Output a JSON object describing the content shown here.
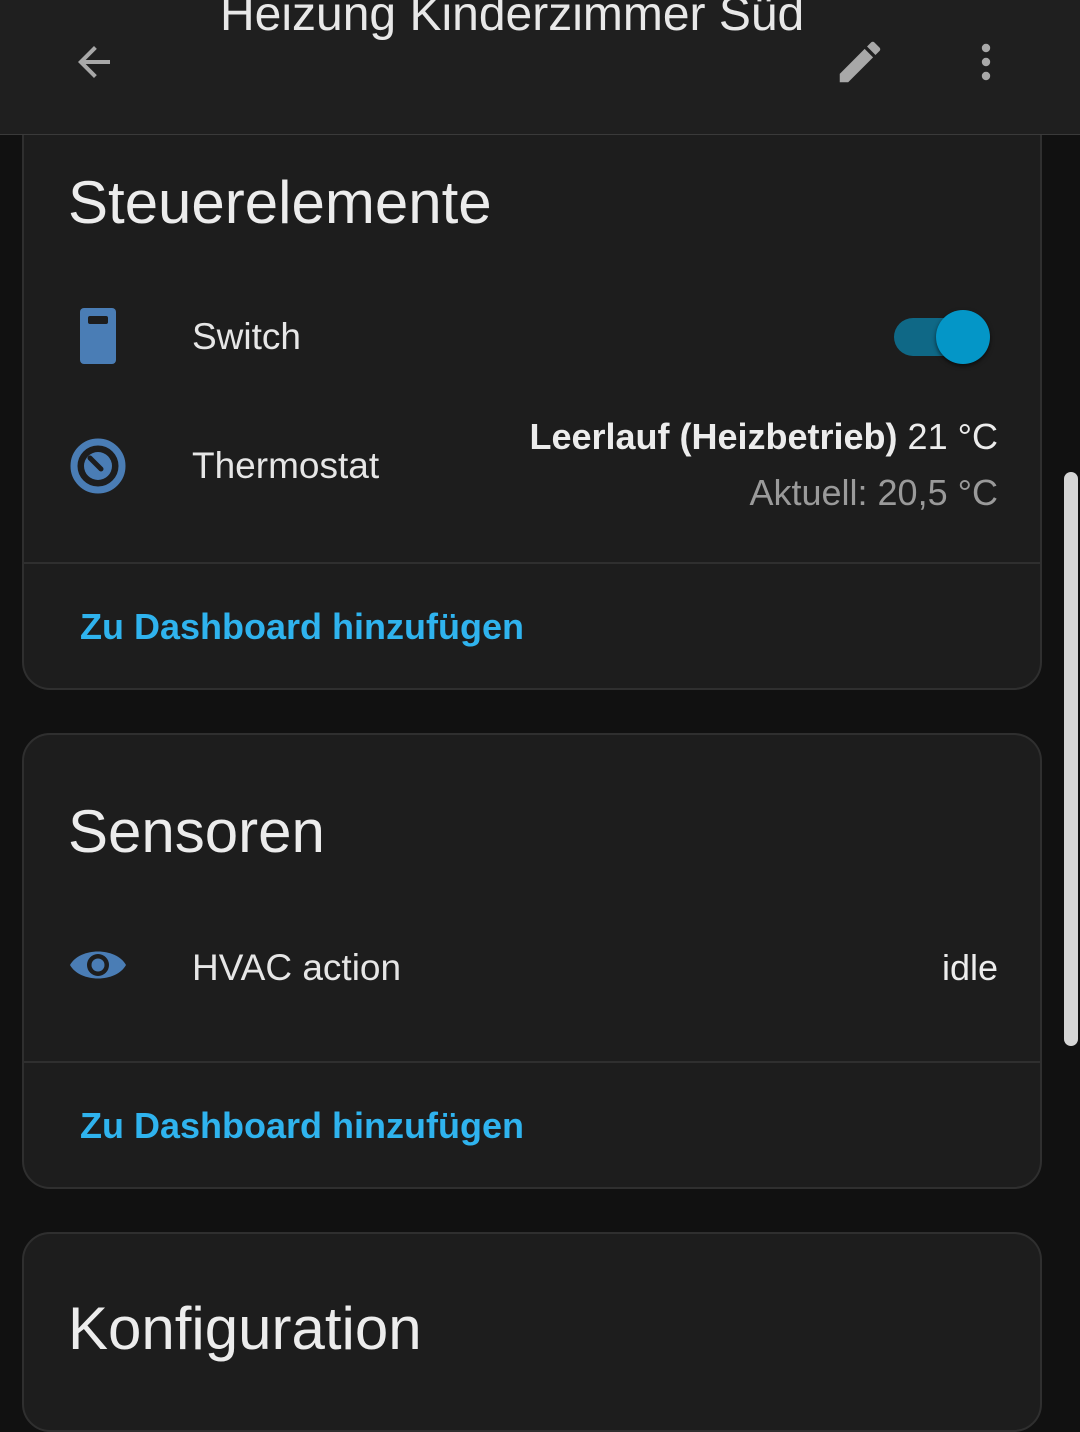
{
  "header": {
    "title": "Heizung Kinderzimmer Süd",
    "back_icon": "arrow-left-icon",
    "edit_icon": "pencil-icon",
    "more_icon": "dots-vertical-icon"
  },
  "controls_card": {
    "title": "Steuerelemente",
    "rows": [
      {
        "icon": "switch-remote-icon",
        "label": "Switch",
        "toggle_on": true
      },
      {
        "icon": "thermostat-icon",
        "label": "Thermostat",
        "state_bold": "Leerlauf (Heizbetrieb)",
        "state_value": "21 °C",
        "state_secondary": "Aktuell: 20,5 °C"
      }
    ],
    "action": "Zu Dashboard hinzufügen"
  },
  "sensors_card": {
    "title": "Sensoren",
    "rows": [
      {
        "icon": "eye-icon",
        "label": "HVAC action",
        "value": "idle"
      }
    ],
    "action": "Zu Dashboard hinzufügen"
  },
  "config_card": {
    "title": "Konfiguration"
  },
  "colors": {
    "accent": "#2fb3ee",
    "icon": "#4a7db5",
    "toggle_thumb": "#0496c7",
    "toggle_track": "#0f6886",
    "background": "#111111",
    "card": "#1d1d1d"
  }
}
